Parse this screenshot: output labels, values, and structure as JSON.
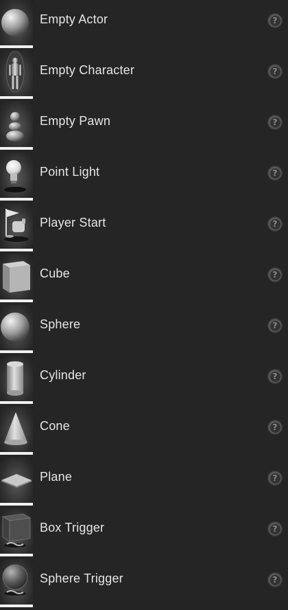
{
  "actors": [
    {
      "label": "Empty Actor",
      "icon": "sphere-icon",
      "help": "?"
    },
    {
      "label": "Empty Character",
      "icon": "mannequin-icon",
      "help": "?"
    },
    {
      "label": "Empty Pawn",
      "icon": "pawn-icon",
      "help": "?"
    },
    {
      "label": "Point Light",
      "icon": "light-bulb-icon",
      "help": "?"
    },
    {
      "label": "Player Start",
      "icon": "player-start-icon",
      "help": "?"
    },
    {
      "label": "Cube",
      "icon": "cube-icon",
      "help": "?"
    },
    {
      "label": "Sphere",
      "icon": "sphere-icon",
      "help": "?"
    },
    {
      "label": "Cylinder",
      "icon": "cylinder-icon",
      "help": "?"
    },
    {
      "label": "Cone",
      "icon": "cone-icon",
      "help": "?"
    },
    {
      "label": "Plane",
      "icon": "plane-icon",
      "help": "?"
    },
    {
      "label": "Box Trigger",
      "icon": "box-trigger-icon",
      "help": "?"
    },
    {
      "label": "Sphere Trigger",
      "icon": "sphere-trigger-icon",
      "help": "?"
    }
  ],
  "colors": {
    "background": "#252525",
    "label": "#e6e6e6",
    "thumb_bar": "#f0f0f0",
    "help_ring": "#5e5e5e"
  }
}
